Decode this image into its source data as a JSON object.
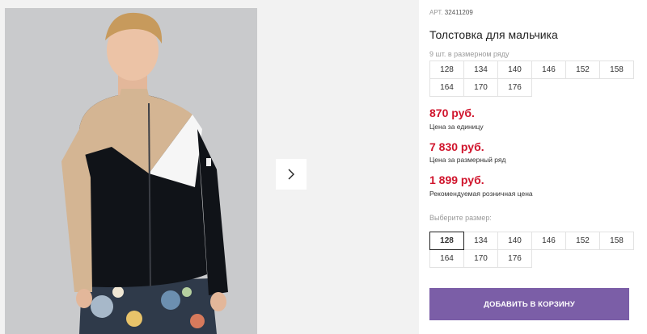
{
  "gallery": {
    "photo_alt": "",
    "next_icon": "chevron-right-icon"
  },
  "product": {
    "article_label": "АРТ.",
    "article_value": "32411209",
    "title": "Толстовка для мальчика",
    "pack_count": "9 шт. в размерном ряду",
    "pack_sizes": [
      "128",
      "134",
      "140",
      "146",
      "152",
      "158",
      "164",
      "170",
      "176"
    ]
  },
  "prices": [
    {
      "value": "870 руб.",
      "note": "Цена за единицу"
    },
    {
      "value": "7 830 руб.",
      "note": "Цена за размерный ряд"
    },
    {
      "value": "1 899 руб.",
      "note": "Рекомендуемая розничная цена"
    }
  ],
  "size_select": {
    "label": "Выберите размер:",
    "options": [
      "128",
      "134",
      "140",
      "146",
      "152",
      "158",
      "164",
      "170",
      "176"
    ],
    "selected": "128"
  },
  "cart": {
    "button_label": "ДОБАВИТЬ В КОРЗИНУ"
  },
  "colors": {
    "price": "#d0142c",
    "button": "#7b5ea7",
    "selected_border": "#222222"
  }
}
